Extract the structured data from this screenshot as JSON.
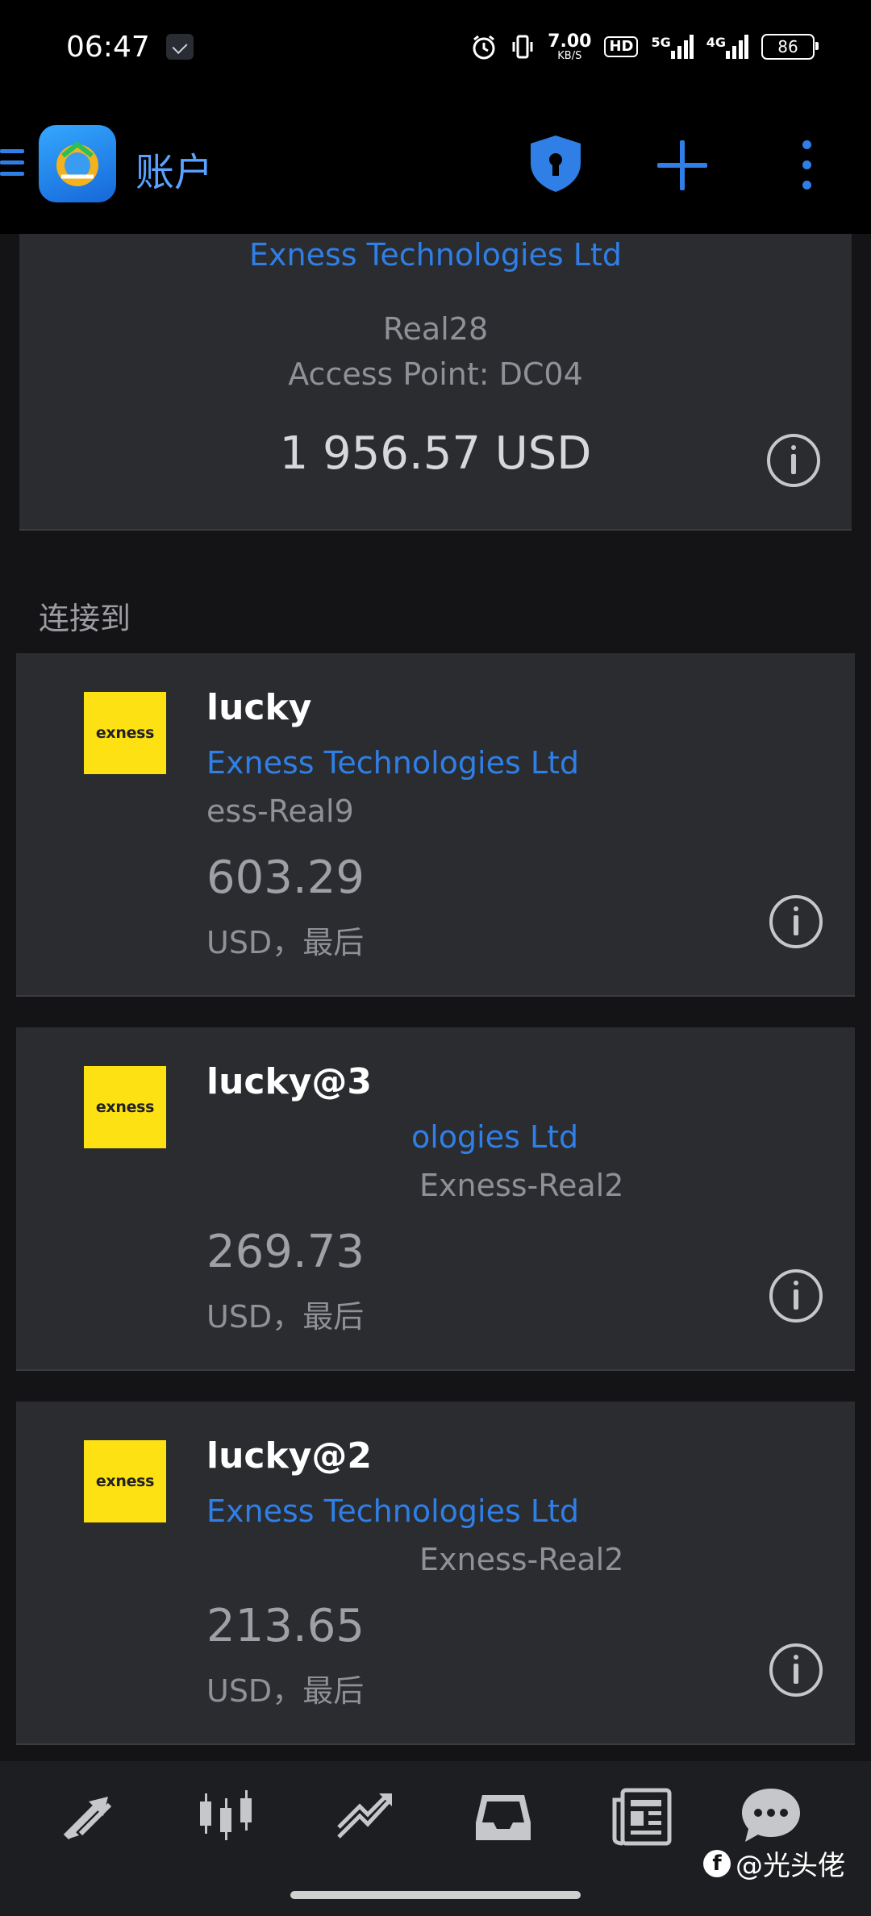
{
  "status_bar": {
    "time": "06:47",
    "net_speed_value": "7.00",
    "net_speed_unit": "KB/S",
    "hd_label": "HD",
    "signal_1": "5G",
    "signal_2": "4G",
    "battery": "86"
  },
  "app_bar": {
    "title": "账户"
  },
  "current_account": {
    "company": "Exness Technologies Ltd",
    "server": "Real28",
    "access_point": "Access Point: DC04",
    "balance": "1 956.57 USD"
  },
  "section_label": "连接到",
  "accounts": [
    {
      "name": "lucky",
      "logo_text": "exness",
      "company": "Exness Technologies Ltd",
      "server": "ess-Real9",
      "balance": "603.29",
      "status": "USD，最后"
    },
    {
      "name": "lucky@3",
      "logo_text": "exness",
      "company": "ologies Ltd",
      "server": "Exness-Real2",
      "balance": "269.73",
      "status": "USD，最后"
    },
    {
      "name": "lucky@2",
      "logo_text": "exness",
      "company": "Exness Technologies Ltd",
      "server": "Exness-Real2",
      "balance": "213.65",
      "status": "USD，最后"
    }
  ],
  "bottom_nav": {
    "items": [
      "quotes-icon",
      "chart-icon",
      "trade-icon",
      "history-icon",
      "news-icon",
      "messages-icon"
    ]
  },
  "watermark": "@光头佬",
  "colors": {
    "accent": "#2f7fe6",
    "background": "#141416",
    "card": "#2b2c30",
    "exness_yellow": "#fde113"
  }
}
